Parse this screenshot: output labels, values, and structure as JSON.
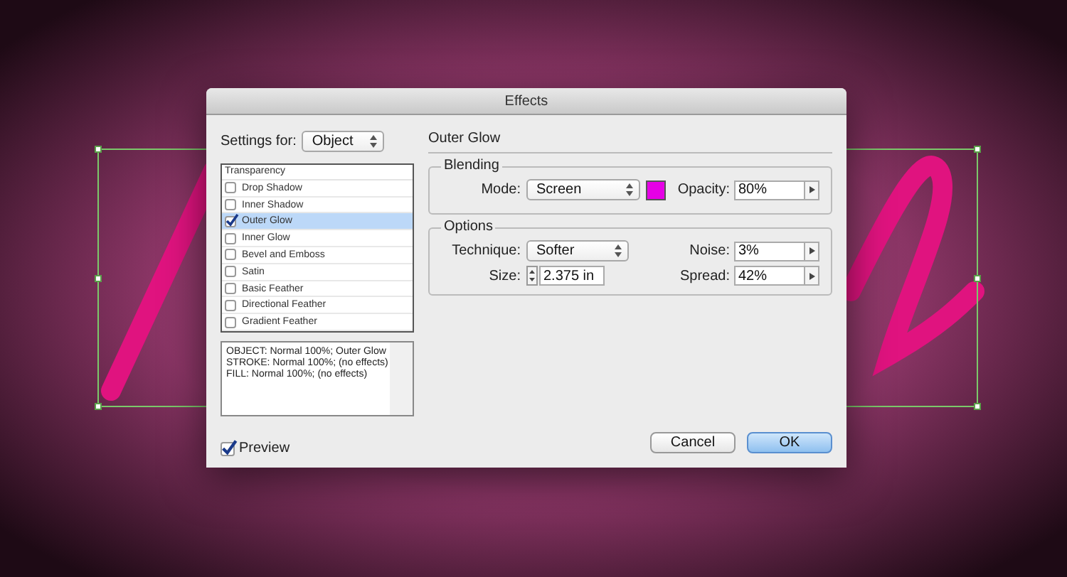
{
  "window": {
    "title": "Effects"
  },
  "settings_for": {
    "label": "Settings for:",
    "value": "Object"
  },
  "effects_list": {
    "header": "Transparency",
    "items": [
      {
        "label": "Drop Shadow",
        "checked": false,
        "selected": false
      },
      {
        "label": "Inner Shadow",
        "checked": false,
        "selected": false
      },
      {
        "label": "Outer Glow",
        "checked": true,
        "selected": true
      },
      {
        "label": "Inner Glow",
        "checked": false,
        "selected": false
      },
      {
        "label": "Bevel and Emboss",
        "checked": false,
        "selected": false
      },
      {
        "label": "Satin",
        "checked": false,
        "selected": false
      },
      {
        "label": "Basic Feather",
        "checked": false,
        "selected": false
      },
      {
        "label": "Directional Feather",
        "checked": false,
        "selected": false
      },
      {
        "label": "Gradient Feather",
        "checked": false,
        "selected": false
      }
    ]
  },
  "summary": [
    "OBJECT: Normal 100%; Outer Glow",
    "STROKE: Normal 100%; (no effects)",
    "FILL: Normal 100%; (no effects)"
  ],
  "preview": {
    "label": "Preview",
    "checked": true
  },
  "panel": {
    "title": "Outer Glow",
    "blending": {
      "title": "Blending",
      "mode_label": "Mode:",
      "mode": "Screen",
      "color": "#e600e6",
      "opacity_label": "Opacity:",
      "opacity": "80%"
    },
    "options": {
      "title": "Options",
      "technique_label": "Technique:",
      "technique": "Softer",
      "size_label": "Size:",
      "size": "2.375 in",
      "noise_label": "Noise:",
      "noise": "3%",
      "spread_label": "Spread:",
      "spread": "42%"
    }
  },
  "buttons": [
    {
      "label": "Cancel",
      "kind": "normal"
    },
    {
      "label": "OK",
      "kind": "default"
    }
  ]
}
